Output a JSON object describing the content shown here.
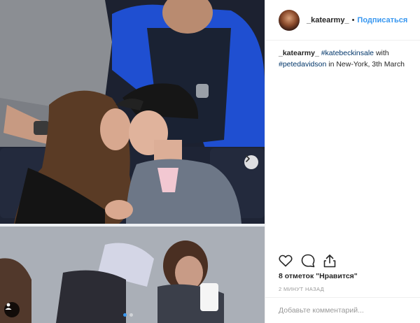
{
  "post": {
    "username": "_katearmy_",
    "separator": "•",
    "follow_label": "Подписаться",
    "caption": {
      "user": "_katearmy_",
      "tag1": "#katebeckinsale",
      "text1": "with",
      "tag2": "#petedavidson",
      "text2": "in New-York, 3th March"
    },
    "likes": "8 отметок \"Нравится\"",
    "timestamp": "2 МИНУТ НАЗАД",
    "comment_placeholder": "Добавьте комментарий..."
  },
  "icons": {
    "next": "chevron-right-icon",
    "tag_user": "user-icon",
    "like": "heart-icon",
    "comment": "comment-bubble-icon",
    "share": "share-icon"
  },
  "carousel": {
    "slides": 2,
    "active_index": 0
  },
  "colors": {
    "link": "#3897f0",
    "hashtag": "#003569",
    "muted": "#999999",
    "border": "#efefef"
  }
}
